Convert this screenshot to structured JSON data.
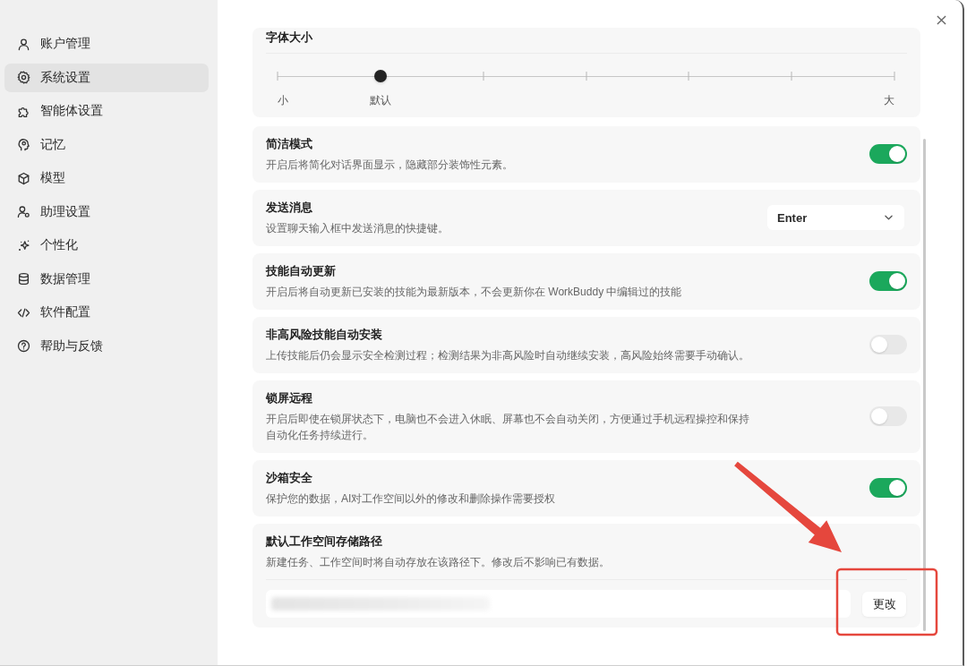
{
  "sidebar": {
    "items": [
      {
        "label": "账户管理",
        "selected": false
      },
      {
        "label": "系统设置",
        "selected": true
      },
      {
        "label": "智能体设置",
        "selected": false
      },
      {
        "label": "记忆",
        "selected": false
      },
      {
        "label": "模型",
        "selected": false
      },
      {
        "label": "助理设置",
        "selected": false
      },
      {
        "label": "个性化",
        "selected": false
      },
      {
        "label": "数据管理",
        "selected": false
      },
      {
        "label": "软件配置",
        "selected": false
      },
      {
        "label": "帮助与反馈",
        "selected": false
      }
    ]
  },
  "settings": {
    "font_size": {
      "title": "字体大小",
      "level": 0.1667,
      "ticks": [
        {
          "kind": "labeled",
          "label": "小"
        },
        {
          "kind": "labeled",
          "label": "默认"
        },
        {
          "kind": "plain"
        },
        {
          "kind": "plain"
        },
        {
          "kind": "plain"
        },
        {
          "kind": "plain"
        },
        {
          "kind": "labeled",
          "label": "大"
        }
      ]
    },
    "rows": [
      {
        "kind": "toggle",
        "title": "简洁模式",
        "description": "开启后将简化对话界面显示，隐藏部分装饰性元素。",
        "on": true
      },
      {
        "kind": "select",
        "title": "发送消息",
        "description": "设置聊天输入框中发送消息的快捷键。",
        "value": "Enter"
      },
      {
        "kind": "toggle",
        "title": "技能自动更新",
        "description": "开启后将自动更新已安装的技能为最新版本，不会更新你在 WorkBuddy 中编辑过的技能",
        "on": true
      },
      {
        "kind": "toggle",
        "title": "非高风险技能自动安装",
        "description": "上传技能后仍会显示安全检测过程；检测结果为非高风险时自动继续安装，高风险始终需要手动确认。",
        "on": false
      },
      {
        "kind": "toggle",
        "title": "锁屏远程",
        "description": "开启后即使在锁屏状态下，电脑也不会进入休眠、屏幕也不会自动关闭，方便通过手机远程操控和保持自动化任务持续进行。",
        "on": false
      },
      {
        "kind": "toggle",
        "title": "沙箱安全",
        "description": "保护您的数据，AI对工作空间以外的修改和删除操作需要授权",
        "on": true
      },
      {
        "kind": "path",
        "title": "默认工作空间存储路径",
        "description": "新建任务、工作空间时将自动存放在该路径下。修改后不影响已有数据。",
        "button": "更改"
      }
    ]
  }
}
